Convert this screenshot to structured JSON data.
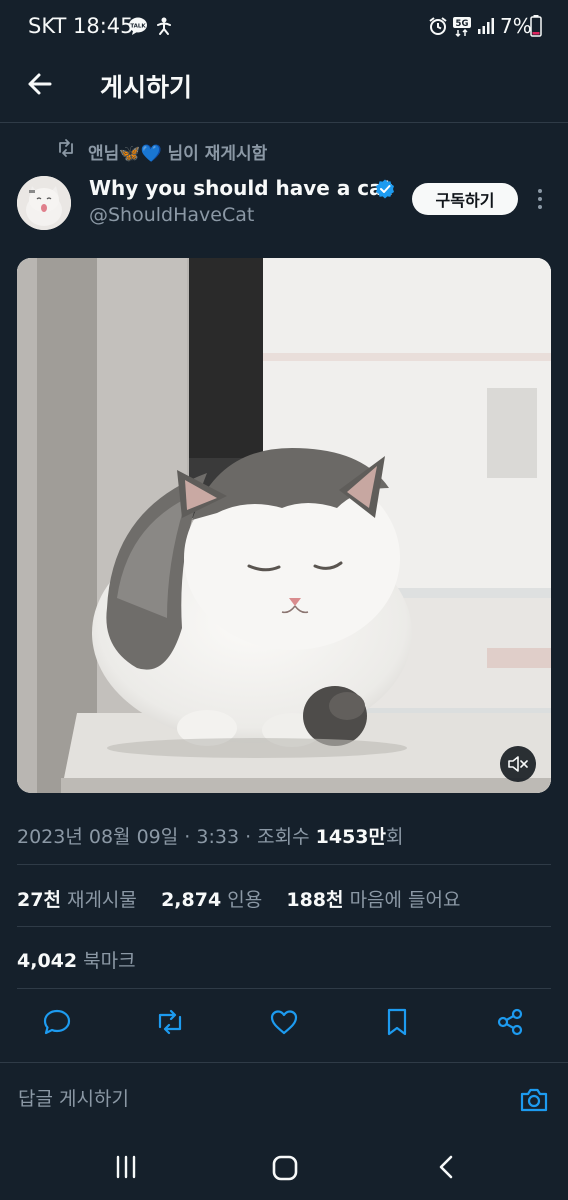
{
  "status_bar": {
    "carrier_time": "SKT 18:45",
    "network": "5G",
    "battery": "7%"
  },
  "header": {
    "title": "게시하기",
    "back_icon": "back-arrow-icon"
  },
  "repost": {
    "user": "앤님",
    "emoji": "🦋💙",
    "suffix": " 님이 재게시함"
  },
  "author": {
    "display_name": "Why you should have a cat",
    "handle": "@ShouldHaveCat",
    "verified": true,
    "subscribe_label": "구독하기"
  },
  "meta": {
    "date": "2023년 08월 09일",
    "sep1": " · ",
    "time": "3:33",
    "sep2": " · 조회수 ",
    "views": "1453만",
    "views_suffix": "회"
  },
  "stats": {
    "reposts_count": "27천",
    "reposts_label": "재게시물",
    "quotes_count": "2,874",
    "quotes_label": "인용",
    "likes_count": "188천",
    "likes_label": "마음에 들어요"
  },
  "bookmarks": {
    "count": "4,042",
    "label": "북마크"
  },
  "actions": [
    "reply-icon",
    "repost-icon",
    "like-icon",
    "bookmark-icon",
    "share-icon"
  ],
  "reply_box": {
    "placeholder": "답글 게시하기"
  },
  "colors": {
    "background": "#15202b",
    "text": "#f7f9f9",
    "secondary": "#8b98a5",
    "accent": "#1d9bf0"
  }
}
